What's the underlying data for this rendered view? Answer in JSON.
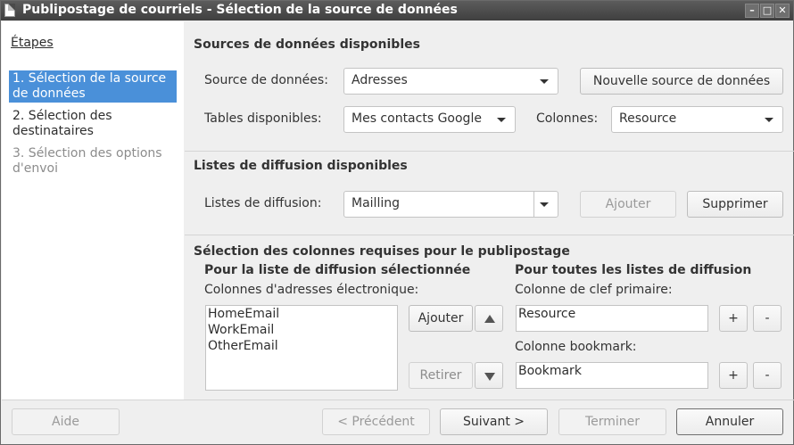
{
  "window": {
    "title": "Publipostage de courriels - Sélection de la source de données",
    "min_glyph": "–",
    "max_glyph": "□",
    "close_glyph": "✕"
  },
  "sidebar": {
    "title": "Étapes",
    "steps": [
      {
        "label": "1. Sélection de la source de données",
        "state": "active"
      },
      {
        "label": "2. Sélection des destinataires",
        "state": "normal"
      },
      {
        "label": "3. Sélection des options d'envoi",
        "state": "disabled"
      }
    ]
  },
  "sources": {
    "heading": "Sources de données disponibles",
    "datasource_label": "Source de données:",
    "datasource_value": "Adresses",
    "new_source_button": "Nouvelle source de données",
    "tables_label": "Tables disponibles:",
    "tables_value": "Mes contacts Google",
    "columns_label": "Colonnes:",
    "columns_value": "Resource"
  },
  "lists": {
    "heading": "Listes de diffusion disponibles",
    "label": "Listes de diffusion:",
    "value": "Mailling",
    "add_button": "Ajouter",
    "remove_button": "Supprimer"
  },
  "columns": {
    "heading": "Sélection des colonnes requises pour le publipostage",
    "left_subheading": "Pour la liste de diffusion sélectionnée",
    "email_columns_label": "Colonnes d'adresses électronique:",
    "email_columns": [
      "HomeEmail",
      "WorkEmail",
      "OtherEmail"
    ],
    "add_button": "Ajouter",
    "remove_button": "Retirer",
    "right_subheading": "Pour toutes les listes de diffusion",
    "primary_key_label": "Colonne de clef primaire:",
    "primary_key_value": "Resource",
    "bookmark_label": "Colonne bookmark:",
    "bookmark_value": "Bookmark",
    "plus": "+",
    "minus": "-"
  },
  "footer": {
    "help": "Aide",
    "previous": "< Précédent",
    "next": "Suivant >",
    "finish": "Terminer",
    "cancel": "Annuler"
  }
}
